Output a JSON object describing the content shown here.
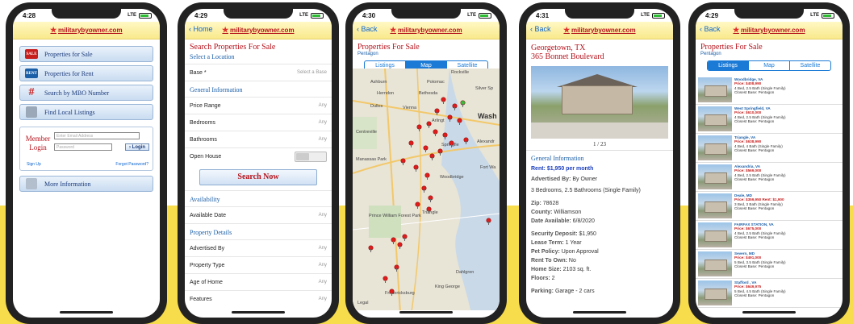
{
  "colors": {
    "accent_red": "#b5121b",
    "link_blue": "#1b5fa8",
    "segment_blue": "#1b7ad6",
    "banner_yellow": "#f7dc4c"
  },
  "logo": "militarybyowner.com",
  "phone1": {
    "time": "4:28",
    "signal": "LTE",
    "menu": [
      {
        "label": "Properties for Sale",
        "icon": "for-sale-sign-icon"
      },
      {
        "label": "Properties for Rent",
        "icon": "for-rent-sign-icon"
      },
      {
        "label": "Search by MBO Number",
        "icon": "hash-icon"
      },
      {
        "label": "Find Local Listings",
        "icon": "document-icon"
      }
    ],
    "login": {
      "title1": "Member",
      "title2": "Login",
      "email_placeholder": "Enter Email Address",
      "password_placeholder": "Password",
      "button": "› Login",
      "signup": "Sign Up",
      "forgot": "Forgot Password?"
    },
    "more": "More Information"
  },
  "phone2": {
    "time": "4:29",
    "signal": "LTE",
    "back": "Home",
    "title": "Search Properties For Sale",
    "select_location": "Select a Location",
    "base_label": "Base *",
    "base_value": "Select a Base",
    "general": "General Information",
    "rows": [
      {
        "label": "Price Range",
        "value": "Any"
      },
      {
        "label": "Bedrooms",
        "value": "Any"
      },
      {
        "label": "Bathrooms",
        "value": "Any"
      }
    ],
    "open_house": "Open House",
    "search_button": "Search Now",
    "availability": "Availability",
    "available_date": "Available Date",
    "available_value": "Any",
    "property_details": "Property Details",
    "details": [
      {
        "label": "Advertised By",
        "value": "Any"
      },
      {
        "label": "Property Type",
        "value": "Any"
      },
      {
        "label": "Age of Home",
        "value": "Any"
      },
      {
        "label": "Features",
        "value": "Any"
      }
    ]
  },
  "phone3": {
    "time": "4:30",
    "signal": "LTE",
    "back": "Back",
    "title": "Properties For Sale",
    "subtitle": "Pentagon",
    "tabs": [
      "Listings",
      "Map",
      "Satellite"
    ],
    "active_tab": "Map",
    "map_labels": [
      "Ashburn",
      "Potomac",
      "Herndon",
      "Bethesda",
      "Silver Sp",
      "Dulles",
      "Vienna",
      "Centreville",
      "Arlingt",
      "Wash",
      "Manassas Park",
      "Springfie",
      "Alexandr",
      "Fort Wa",
      "Woodbridge",
      "Prince William Forest Park",
      "Triangle",
      "Dahlgren",
      "King George",
      "Fredericksburg",
      "Rockville",
      "Legal"
    ]
  },
  "phone4": {
    "time": "4:31",
    "signal": "LTE",
    "back": "Back",
    "title1": "Georgetown, TX",
    "title2": "365 Bonnet Boulevard",
    "counter": "1 / 23",
    "general": "General Information",
    "rent": "Rent: $1,950 per month",
    "lines1": [
      {
        "label": "Advertised By:",
        "value": " By Owner"
      },
      {
        "label": "",
        "value": "3 Bedrooms, 2.5 Bathrooms (Single Family)"
      }
    ],
    "lines2": [
      {
        "label": "Zip:",
        "value": " 78628"
      },
      {
        "label": "County:",
        "value": " Williamson"
      },
      {
        "label": "Date Available:",
        "value": " 6/8/2020"
      }
    ],
    "lines3": [
      {
        "label": "Security Deposit:",
        "value": " $1,950"
      },
      {
        "label": "Lease Term:",
        "value": " 1 Year"
      },
      {
        "label": "Pet Policy:",
        "value": " Upon Approval"
      },
      {
        "label": "Rent To Own:",
        "value": " No"
      },
      {
        "label": "Home Size:",
        "value": " 2103 sq. ft."
      },
      {
        "label": "Floors:",
        "value": " 2"
      }
    ],
    "parking": {
      "label": "Parking:",
      "value": " Garage - 2 cars"
    }
  },
  "phone5": {
    "time": "4:29",
    "signal": "LTE",
    "back": "Back",
    "title": "Properties For Sale",
    "subtitle": "Pentagon",
    "tabs": [
      "Listings",
      "Map",
      "Satellite"
    ],
    "active_tab": "Listings",
    "listings": [
      {
        "place": "Woodbridge, VA",
        "price": "Price: $408,990",
        "beds": "4 Bed, 2.5 Bath (Single Family)",
        "base": "Closest Base: Pentagon"
      },
      {
        "place": "West Springfield, VA",
        "price": "Price: $610,000",
        "beds": "4 Bed, 2.5 Bath (Single Family)",
        "base": "Closest Base: Pentagon"
      },
      {
        "place": "Triangle, VA",
        "price": "Price: $638,990",
        "beds": "4 Bed, 4 Bath (Single Family)",
        "base": "Closest Base: Pentagon"
      },
      {
        "place": "Alexandria, VA",
        "price": "Price: $569,000",
        "beds": "4 Bed, 2.5 Bath (Single Family)",
        "base": "Closest Base: Pentagon"
      },
      {
        "place": "Deale, MD",
        "price": "Price: $359,950  Rent: $1,900",
        "beds": "3 Bed, 3 Bath (Single Family)",
        "base": "Closest Base: Pentagon"
      },
      {
        "place": "FAIRFAX STATION, VA",
        "price": "Price: $675,000",
        "beds": "4 Bed, 2.5 Bath (Single Family)",
        "base": "Closest Base: Pentagon"
      },
      {
        "place": "Severn, MD",
        "price": "Price: $491,000",
        "beds": "5 Bed, 3.5 Bath (Single Family)",
        "base": "Closest Base: Pentagon"
      },
      {
        "place": "Stafford , VA",
        "price": "Price: $649,975",
        "beds": "5 Bed, 4.5 Bath (Single Family)",
        "base": "Closest Base: Pentagon"
      }
    ]
  }
}
